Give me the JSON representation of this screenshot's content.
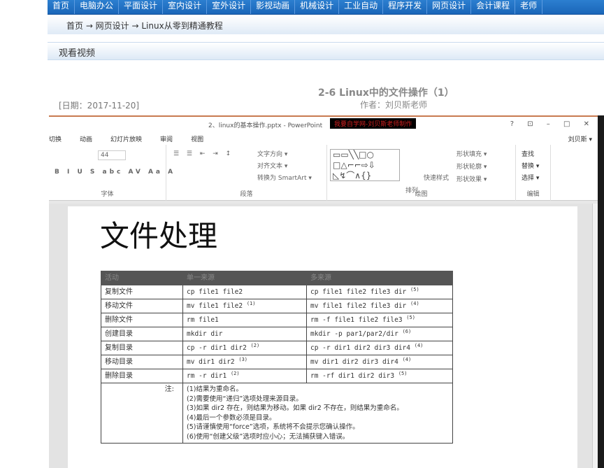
{
  "nav": [
    "首页",
    "电脑办公",
    "平面设计",
    "室内设计",
    "室外设计",
    "影视动画",
    "机械设计",
    "工业自动",
    "程序开发",
    "网页设计",
    "会计课程",
    "老师"
  ],
  "breadcrumb": "首页 → 网页设计 → Linux从零到精通教程",
  "section": "观看视频",
  "date": "[日期：2017-11-20]",
  "title": "2-6 Linux中的文件操作（1）",
  "author": "作者：刘贝斯老师",
  "ppt": {
    "window_title": "2、linux的基本操作.pptx - PowerPoint",
    "watermark": "我要自学网-刘贝斯老师制作",
    "controls": "? ⊡ – □ ✕",
    "tabs": [
      "切换",
      "动画",
      "幻灯片放映",
      "审阅",
      "视图"
    ],
    "user": "刘贝斯 ▾",
    "groups": {
      "font": "字体",
      "paragraph": "段落",
      "drawing": "绘图",
      "editing": "编辑"
    },
    "font_size": "44",
    "para_items": [
      "文字方向 ▾",
      "对齐文本 ▾",
      "转换为 SmartArt ▾"
    ],
    "draw_items": [
      "排列",
      "快速样式",
      "形状填充 ▾",
      "形状轮廓 ▾",
      "形状效果 ▾"
    ],
    "edit_items": [
      "查找",
      "替换 ▾",
      "选择 ▾"
    ],
    "slide_title": "文件处理",
    "headers": [
      "活动",
      "单一来源",
      "多来源"
    ],
    "rows": [
      [
        "复制文件",
        "cp file1 file2",
        "",
        "cp file1 file2 file3 dir",
        "(5)"
      ],
      [
        "移动文件",
        "mv file1 file2",
        "(1)",
        "mv file1 file2 file3 dir",
        "(4)"
      ],
      [
        "删除文件",
        "rm file1",
        "",
        "rm -f file1 file2 file3",
        "(5)"
      ],
      [
        "创建目录",
        "mkdir dir",
        "",
        "mkdir -p par1/par2/dir",
        "(6)"
      ],
      [
        "复制目录",
        "cp -r dir1 dir2",
        "(2)",
        "cp -r dir1 dir2 dir3 dir4",
        "(4)"
      ],
      [
        "移动目录",
        "mv dir1 dir2",
        "(3)",
        "mv dir1 dir2 dir3 dir4",
        "(4)"
      ],
      [
        "删除目录",
        "rm -r dir1",
        "(2)",
        "rm -rf dir1 dir2 dir3",
        "(5)"
      ]
    ],
    "note_label": "注:",
    "notes": [
      "(1)结果为重命名。",
      "(2)需要使用“递归”选项处理来源目录。",
      "(3)如果 dir2 存在，则结果为移动。如果 dir2 不存在，则结果为重命名。",
      "(4)最后一个参数必须是目录。",
      "(5)请谨慎使用“force”选项，系统将不会提示您确认操作。",
      "(6)使用“创建父级”选项时应小心；无法捕获键入错误。"
    ]
  }
}
